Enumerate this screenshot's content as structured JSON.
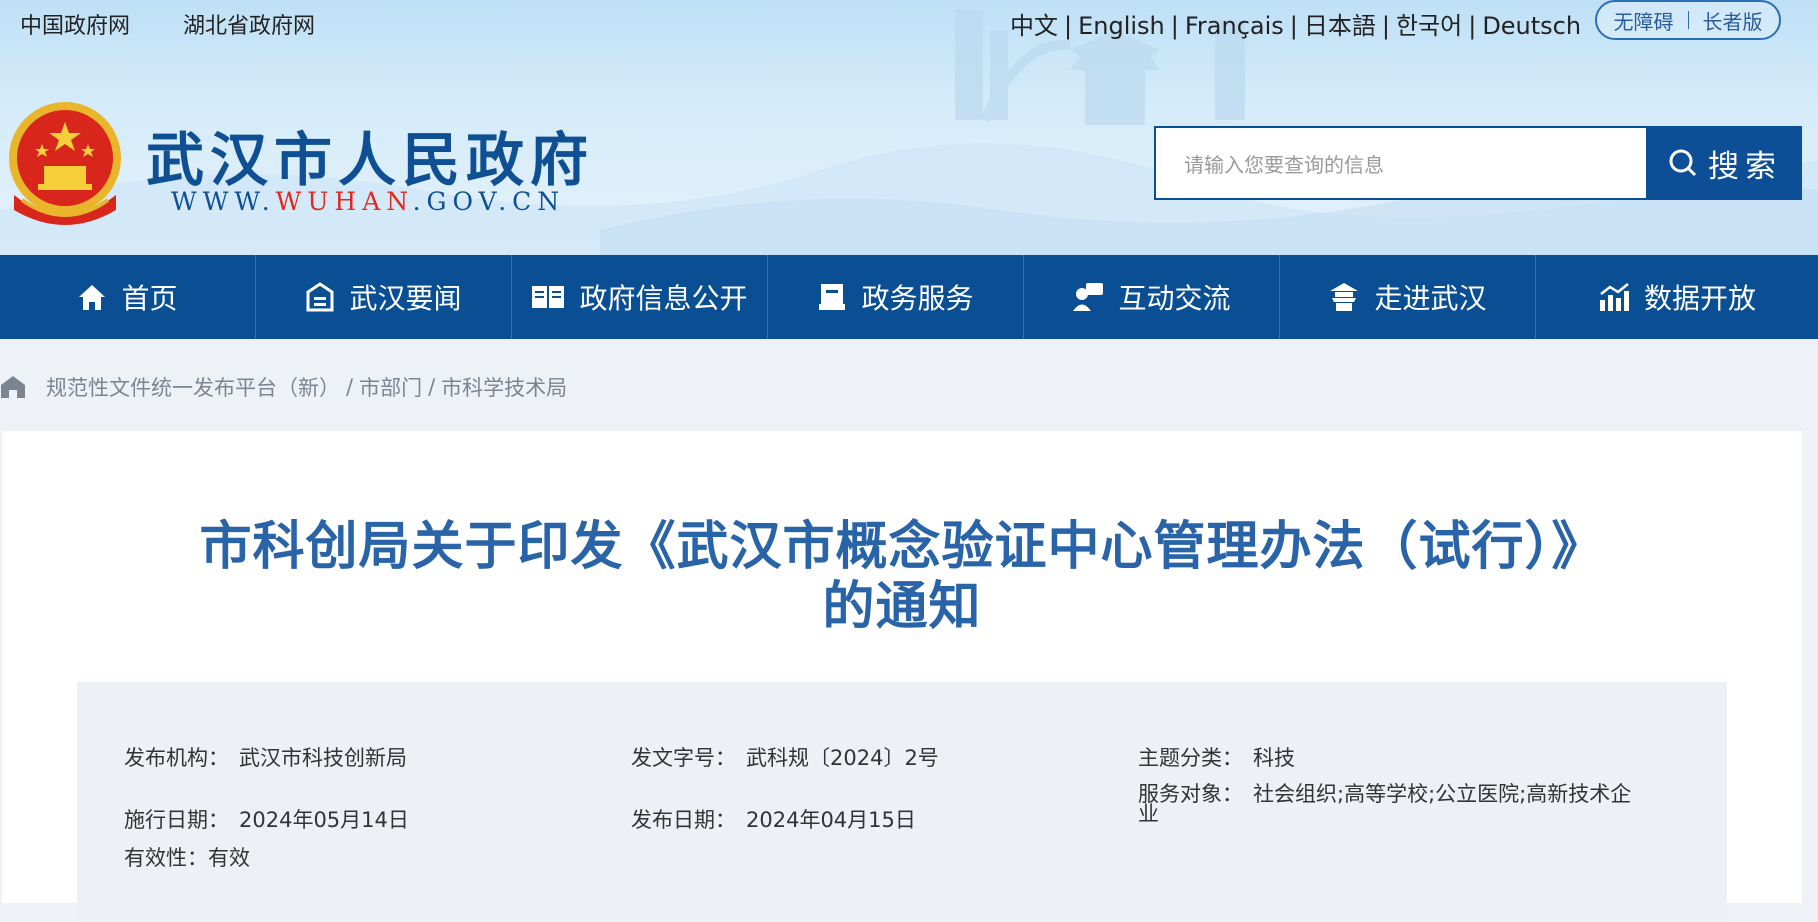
{
  "top_links": [
    "中国政府网",
    "湖北省政府网"
  ],
  "languages": [
    "中文",
    "English",
    "Français",
    "日本語",
    "한국어",
    "Deutsch"
  ],
  "accessibility": {
    "barrier_free": "无障碍",
    "elder": "长者版"
  },
  "site": {
    "title": "武汉市人民政府",
    "url_prefix": "WWW.",
    "url_highlight": "WUHAN",
    "url_suffix": ".GOV.CN"
  },
  "search": {
    "placeholder": "请输入您要查询的信息",
    "button": "搜索"
  },
  "nav": [
    {
      "label": "首页",
      "icon": "home-icon"
    },
    {
      "label": "武汉要闻",
      "icon": "news-icon"
    },
    {
      "label": "政府信息公开",
      "icon": "book-icon"
    },
    {
      "label": "政务服务",
      "icon": "service-icon"
    },
    {
      "label": "互动交流",
      "icon": "chat-icon"
    },
    {
      "label": "走进武汉",
      "icon": "tower-icon"
    },
    {
      "label": "数据开放",
      "icon": "chart-icon"
    }
  ],
  "breadcrumb": [
    "规范性文件统一发布平台（新）",
    "市部门",
    "市科学技术局"
  ],
  "article": {
    "title_line1": "市科创局关于印发《武汉市概念验证中心管理办法（试行）》",
    "title_line2": "的通知"
  },
  "meta": {
    "issuer_label": "发布机构：",
    "issuer": "武汉市科技创新局",
    "docno_label": "发文字号：",
    "docno": "武科规〔2024〕2号",
    "topic_label": "主题分类：",
    "topic": "科技",
    "effective_label": "施行日期：",
    "effective": "2024年05月14日",
    "publish_label": "发布日期：",
    "publish": "2024年04月15日",
    "target_label": "服务对象：",
    "target_line1": "社会组织;高等学校;公立医院;高新技术企",
    "target_line2": "业",
    "validity_label": "有效性：",
    "validity": "有效"
  },
  "colors": {
    "brand_blue": "#0a4e94",
    "title_blue": "#2a64a8",
    "url_red": "#e02a1f"
  }
}
